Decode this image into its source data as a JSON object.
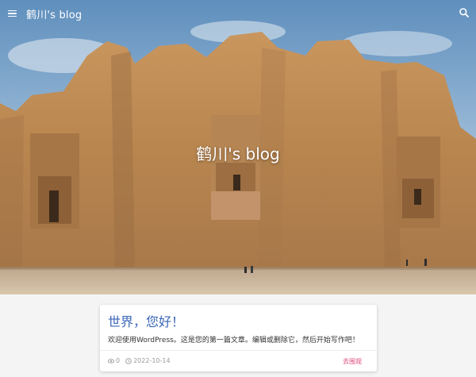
{
  "header": {
    "site_name": "鹤川's blog",
    "menu_icon": "menu-icon",
    "search_icon": "search-icon"
  },
  "hero": {
    "title": "鹤川's blog"
  },
  "post": {
    "title": "世界，您好！",
    "excerpt": "欢迎使用WordPress。这是您的第一篇文章。编辑或删除它，然后开始写作吧！",
    "views": "0",
    "date": "2022-10-14",
    "read_link": "去围观"
  },
  "colors": {
    "title_blue": "#3a66b8",
    "link_pink": "#e0457b"
  }
}
